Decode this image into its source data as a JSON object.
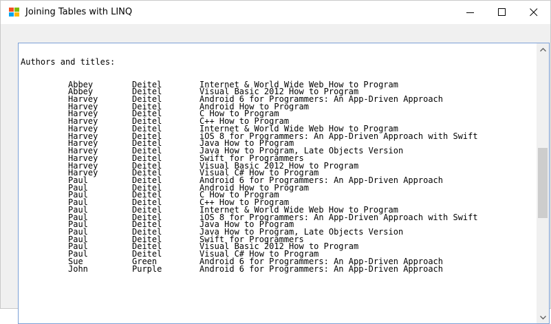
{
  "window": {
    "title": "Joining Tables with LINQ",
    "icon": "windows-form-icon",
    "controls": {
      "minimize_icon": "minimize-icon",
      "maximize_icon": "maximize-icon",
      "close_icon": "close-icon"
    }
  },
  "output": {
    "header": "Authors and titles:",
    "rows": [
      {
        "first": "Abbey",
        "last": "Deitel",
        "title": "Internet & World Wide Web How to Program"
      },
      {
        "first": "Abbey",
        "last": "Deitel",
        "title": "Visual Basic 2012 How to Program"
      },
      {
        "first": "Harvey",
        "last": "Deitel",
        "title": "Android 6 for Programmers: An App-Driven Approach"
      },
      {
        "first": "Harvey",
        "last": "Deitel",
        "title": "Android How to Program"
      },
      {
        "first": "Harvey",
        "last": "Deitel",
        "title": "C How to Program"
      },
      {
        "first": "Harvey",
        "last": "Deitel",
        "title": "C++ How to Program"
      },
      {
        "first": "Harvey",
        "last": "Deitel",
        "title": "Internet & World Wide Web How to Program"
      },
      {
        "first": "Harvey",
        "last": "Deitel",
        "title": "iOS 8 for Programmers: An App-Driven Approach with Swift"
      },
      {
        "first": "Harvey",
        "last": "Deitel",
        "title": "Java How to Program"
      },
      {
        "first": "Harvey",
        "last": "Deitel",
        "title": "Java How to Program, Late Objects Version"
      },
      {
        "first": "Harvey",
        "last": "Deitel",
        "title": "Swift for Programmers"
      },
      {
        "first": "Harvey",
        "last": "Deitel",
        "title": "Visual Basic 2012 How to Program"
      },
      {
        "first": "Harvey",
        "last": "Deitel",
        "title": "Visual C# How to Program"
      },
      {
        "first": "Paul",
        "last": "Deitel",
        "title": "Android 6 for Programmers: An App-Driven Approach"
      },
      {
        "first": "Paul",
        "last": "Deitel",
        "title": "Android How to Program"
      },
      {
        "first": "Paul",
        "last": "Deitel",
        "title": "C How to Program"
      },
      {
        "first": "Paul",
        "last": "Deitel",
        "title": "C++ How to Program"
      },
      {
        "first": "Paul",
        "last": "Deitel",
        "title": "Internet & World Wide Web How to Program"
      },
      {
        "first": "Paul",
        "last": "Deitel",
        "title": "iOS 8 for Programmers: An App-Driven Approach with Swift"
      },
      {
        "first": "Paul",
        "last": "Deitel",
        "title": "Java How to Program"
      },
      {
        "first": "Paul",
        "last": "Deitel",
        "title": "Java How to Program, Late Objects Version"
      },
      {
        "first": "Paul",
        "last": "Deitel",
        "title": "Swift for Programmers"
      },
      {
        "first": "Paul",
        "last": "Deitel",
        "title": "Visual Basic 2012 How to Program"
      },
      {
        "first": "Paul",
        "last": "Deitel",
        "title": "Visual C# How to Program"
      },
      {
        "first": "Sue",
        "last": "Green",
        "title": "Android 6 for Programmers: An App-Driven Approach"
      },
      {
        "first": "John",
        "last": "Purple",
        "title": "Android 6 for Programmers: An App-Driven Approach"
      }
    ]
  },
  "scrollbar": {
    "up_icon": "scroll-up-arrow-icon",
    "down_icon": "scroll-down-arrow-icon"
  },
  "colors": {
    "textbox_border": "#7a9fd6",
    "window_bg": "#f0f0f0",
    "thumb": "#cdcdcd"
  }
}
